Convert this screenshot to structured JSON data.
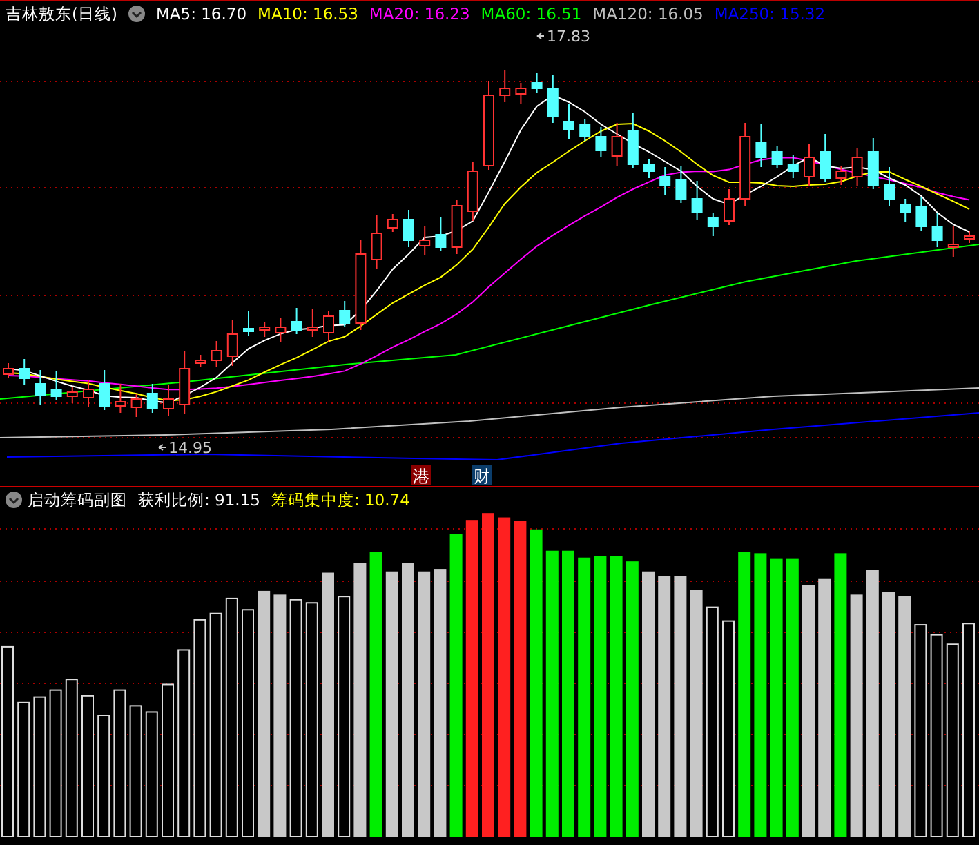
{
  "main_panel": {
    "title": "吉林敖东(日线)",
    "moving_averages": [
      {
        "label": "MA5: 16.70",
        "color": "#ffffff"
      },
      {
        "label": "MA10: 16.53",
        "color": "#ffff00"
      },
      {
        "label": "MA20: 16.23",
        "color": "#ff00ff"
      },
      {
        "label": "MA60: 16.51",
        "color": "#00ff00"
      },
      {
        "label": "MA120: 16.05",
        "color": "#c0c0c0"
      },
      {
        "label": "MA250: 15.32",
        "color": "#0000ff"
      }
    ],
    "high_label": "17.83",
    "low_label": "14.95",
    "event_markers": [
      {
        "text": "港",
        "color": "#8b0000"
      },
      {
        "text": "财",
        "color": "#0b3d6b"
      }
    ]
  },
  "sub_panel": {
    "title": "启动筹码副图",
    "indicators": [
      {
        "label": "获利比例: 91.15",
        "color": "#ffffff"
      },
      {
        "label": "筹码集中度: 10.74",
        "color": "#ffff00"
      }
    ]
  }
}
